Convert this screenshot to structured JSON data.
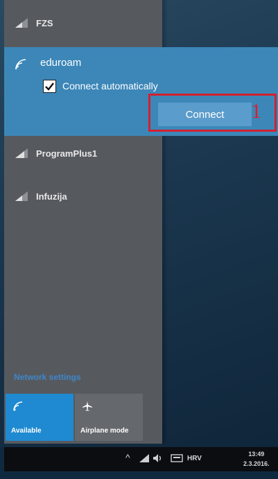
{
  "networks": [
    {
      "name": "FZS"
    },
    {
      "name": "ProgramPlus1"
    },
    {
      "name": "Infuzija"
    }
  ],
  "selected_network": {
    "name": "eduroam",
    "connect_automatically_label": "Connect automatically",
    "connect_automatically_checked": true,
    "connect_button_label": "Connect"
  },
  "annotation": {
    "number": "1"
  },
  "network_settings_label": "Network settings",
  "quick_actions": [
    {
      "label": "Available",
      "icon": "wifi-icon",
      "active": true
    },
    {
      "label": "Airplane mode",
      "icon": "airplane-icon",
      "active": false
    }
  ],
  "taskbar": {
    "language": "HRV",
    "time": "13:49",
    "date": "2.3.2016."
  },
  "colors": {
    "accent": "#3c87b8",
    "tile_active": "#1f8ad1",
    "annotation_red": "#d32030"
  }
}
